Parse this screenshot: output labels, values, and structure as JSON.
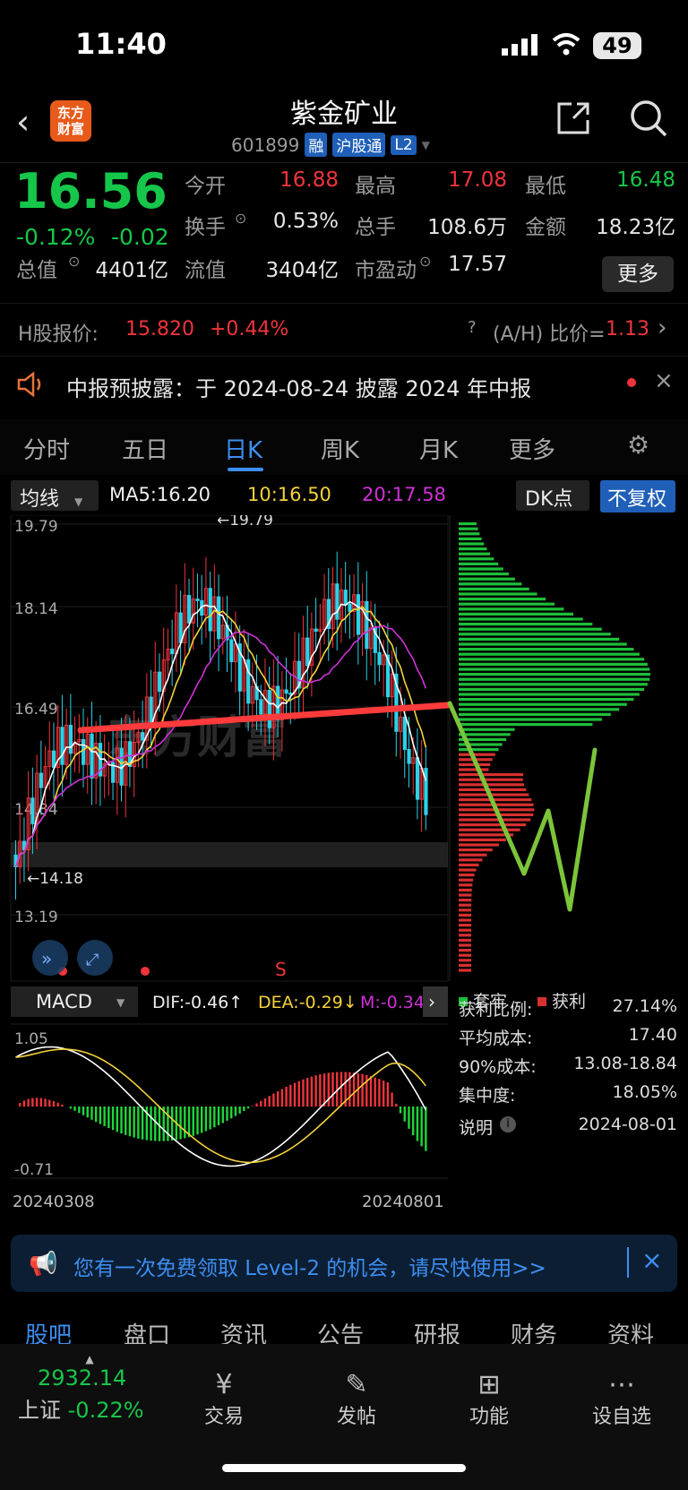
{
  "status_bar": {
    "time": "11:40",
    "battery": "49"
  },
  "header": {
    "logo_line1": "东方",
    "logo_line2": "财富",
    "title": "紫金矿业",
    "code": "601899",
    "tags": [
      "融",
      "沪股通",
      "L2"
    ]
  },
  "quote": {
    "price": "16.56",
    "change_pct": "-0.12%",
    "change_abs": "-0.02",
    "rows": [
      [
        {
          "label": "今开",
          "value": "16.88",
          "color": "red"
        },
        {
          "label": "最高",
          "value": "17.08",
          "color": "red"
        },
        {
          "label": "最低",
          "value": "16.48",
          "color": "green"
        }
      ],
      [
        {
          "label": "换手",
          "value": "0.53%",
          "color": "white"
        },
        {
          "label": "总手",
          "value": "108.6万",
          "color": "white"
        },
        {
          "label": "金额",
          "value": "18.23亿",
          "color": "white"
        }
      ],
      [
        {
          "label": "总值",
          "value": "4401亿",
          "color": "white"
        },
        {
          "label": "流值",
          "value": "3404亿",
          "color": "white"
        },
        {
          "label": "市盈动",
          "value": "17.57",
          "color": "white"
        }
      ]
    ],
    "more_label": "更多"
  },
  "h_share": {
    "label": "H股报价:",
    "price": "15.820",
    "change": "+0.44%",
    "ratio_label": "(A/H) 比价=",
    "ratio": "1.13"
  },
  "notice": {
    "text": "中报预披露：于 2024-08-24 披露 2024 年中报"
  },
  "tabs": [
    "分时",
    "五日",
    "日K",
    "周K",
    "月K",
    "更多"
  ],
  "active_tab": "日K",
  "indicator_bar": {
    "select": "均线",
    "ma5": "MA5:16.20",
    "ma10": "10:16.50",
    "ma20": "20:17.58",
    "dk": "DK点",
    "fq": "不复权"
  },
  "chart_data": {
    "type": "candlestick",
    "y_ticks": [
      "19.79",
      "18.14",
      "16.49",
      "14.84",
      "13.19"
    ],
    "high_label": "19.79",
    "low_label": "14.18",
    "signal": "S",
    "x_labels": [
      "20240308",
      "20240801"
    ],
    "watermark": "东方财富"
  },
  "macd": {
    "select": "MACD",
    "dif": "DIF:-0.46",
    "dea": "DEA:-0.29",
    "m": "M:-0.34",
    "y_top": "1.05",
    "y_bottom": "-0.71"
  },
  "chip_dist": {
    "legend_trapped": "套牢",
    "legend_profit": "获利",
    "stats": [
      {
        "label": "获利比例:",
        "value": "27.14%"
      },
      {
        "label": "平均成本:",
        "value": "17.40"
      },
      {
        "label": "90%成本:",
        "value": "13.08-18.84"
      },
      {
        "label": "集中度:",
        "value": "18.05%"
      }
    ],
    "note_label": "说明",
    "date": "2024-08-01"
  },
  "banner": {
    "text": "您有一次免费领取 Level-2 的机会，请尽快使用>>"
  },
  "bottom_tabs": [
    "股吧",
    "盘口",
    "资讯",
    "公告",
    "研报",
    "财务",
    "资料"
  ],
  "dock": {
    "index_value": "2932.14",
    "index_name": "上证",
    "index_change": "-0.22%",
    "items": [
      "交易",
      "发帖",
      "功能",
      "设自选"
    ]
  }
}
